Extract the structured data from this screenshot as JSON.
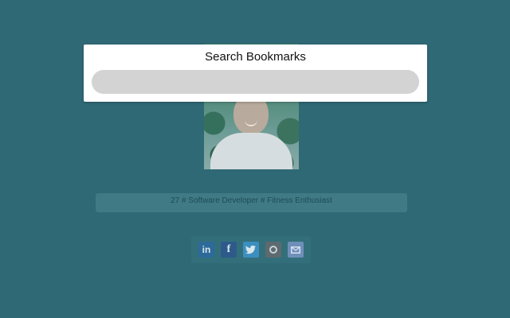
{
  "profile": {
    "tagline": "27 # Software Developer # Fitness Enthusiast",
    "photo_alt": "profile photo"
  },
  "social": [
    {
      "name": "linkedin-icon",
      "glyph": "in"
    },
    {
      "name": "facebook-icon",
      "glyph": "f"
    },
    {
      "name": "twitter-icon",
      "glyph": "bird"
    },
    {
      "name": "instagram-icon",
      "glyph": "camera"
    },
    {
      "name": "email-icon",
      "glyph": "envelope"
    }
  ],
  "overlay": {
    "title": "Search Bookmarks",
    "search_value": "",
    "search_placeholder": ""
  },
  "colors": {
    "page_background": "#2e6975",
    "overlay_background": "#ffffff",
    "search_field": "#d3d3d3"
  }
}
